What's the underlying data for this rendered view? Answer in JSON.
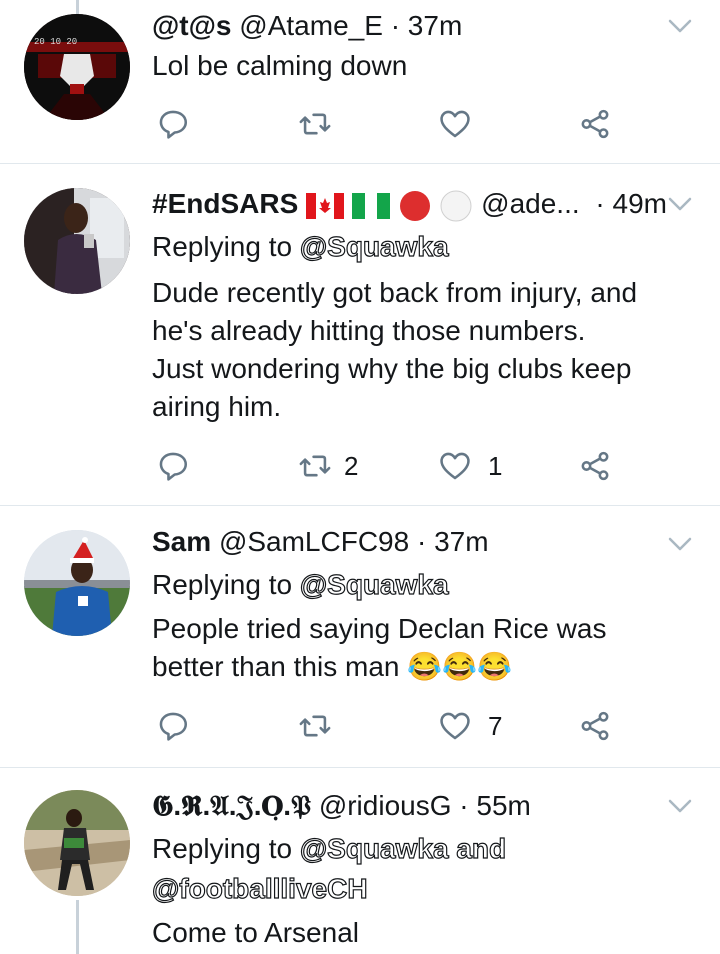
{
  "tweets": [
    {
      "name": "@t@s",
      "handle": "@Atame_E",
      "dot": "·",
      "time": "37m",
      "lines": [
        "Lol be calming down"
      ],
      "reply_count": "",
      "retweet_count": "",
      "like_count": ""
    },
    {
      "name": "#EndSARS",
      "handle": "@ade...",
      "dot": "·",
      "time": "49m",
      "replying_prefix": "Replying to",
      "replying_to": "@Squawka",
      "lines": [
        "Dude recently got back from injury, and",
        "he's already hitting those numbers.",
        "Just wondering why the big clubs keep",
        "airing him."
      ],
      "reply_count": "",
      "retweet_count": "2",
      "like_count": "1"
    },
    {
      "name": "Sam",
      "handle": "@SamLCFC98",
      "dot": "·",
      "time": "37m",
      "replying_prefix": "Replying to",
      "replying_to": "@Squawka",
      "lines": [
        "People tried saying Declan Rice was",
        "better than this man"
      ],
      "emoji": "😂😂😂",
      "reply_count": "",
      "retweet_count": "",
      "like_count": "7"
    },
    {
      "name": "𝕲.𝕽.𝔄.𝔍.𝐎̣.𝔓",
      "handle": "@ridiousG",
      "dot": "·",
      "time": "55m",
      "replying_prefix": "Replying to",
      "replying_to": "@Squawka and",
      "replying_to2": "@footballliveCH",
      "lines": [
        "Come to Arsenal"
      ]
    }
  ],
  "colors": {
    "text": "#14171a",
    "icon": "#657786",
    "divider": "#e1e8ed",
    "thread": "#c8d1d9"
  }
}
